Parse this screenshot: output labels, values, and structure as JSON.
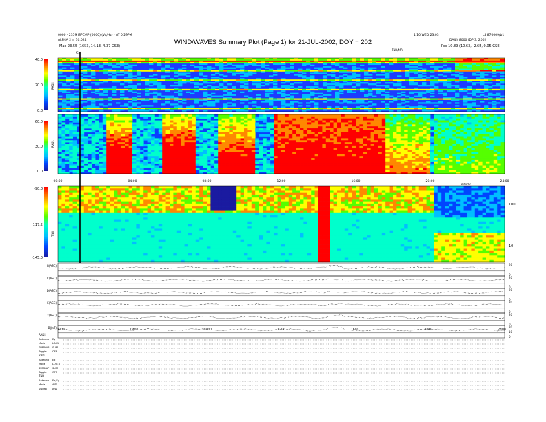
{
  "header": {
    "title": "WIND/WAVES Summary Plot (Page 1) for 21-JUL-2002, DOY = 202",
    "left_line1": "0000 - 2359 ISPCMP (0000) (Vs/Hz) - AT 0:29PM",
    "left_line2": "ALPHA 2 = 10.024",
    "left_line3": "Max 23.55 (1653, 14.13, 4.37 GSE)",
    "left_line3_label": "Pos",
    "right_line1": "1.10 WED 23:03",
    "right_line2": "DAILY 8000 (DP 3, 2002",
    "right_line3": "Pos 10.89 (10.63, -2.65, 0.05 GSE)",
    "right_top": "L5 870009/b1",
    "tnr_label": "TNR/MR",
    "cal_label": "Cal"
  },
  "chart_data": [
    {
      "type": "heatmap",
      "name": "RAD2",
      "ylabel": "RAD2",
      "colorbar_ticks": [
        "40.0",
        "20.0",
        "0.0"
      ],
      "colorbar_range": [
        0,
        40
      ],
      "xlim": [
        0,
        24
      ],
      "units": "MHz"
    },
    {
      "type": "heatmap",
      "name": "RAD1",
      "ylabel": "RAD1",
      "colorbar_ticks": [
        "60.0",
        "30.0",
        "0.0"
      ],
      "colorbar_range": [
        0,
        60
      ],
      "xlim": [
        0,
        24
      ],
      "x_ticks": [
        "00:00",
        "04:00",
        "08:00",
        "12:00",
        "16:00",
        "20:00",
        "24:00"
      ],
      "x_unit_label": "SRFQHU"
    },
    {
      "type": "heatmap",
      "name": "TNR",
      "ylabel": "TNR",
      "colorbar_ticks": [
        "-90.0",
        "-117.5",
        "-145.0"
      ],
      "colorbar_range": [
        -145,
        -90
      ],
      "right_ticks": [
        "100",
        "10"
      ],
      "xlim": [
        0,
        24
      ]
    },
    {
      "type": "line",
      "name": "B(ASC)",
      "label": "B(ASC)",
      "right_ticks": [
        "20",
        "0"
      ]
    },
    {
      "type": "line",
      "name": "C(ASC)",
      "label": "C(ASC)",
      "right_ticks": [
        "20",
        "0"
      ]
    },
    {
      "type": "line",
      "name": "D(ASC)",
      "label": "D(ASC)",
      "right_ticks": [
        "20",
        "0"
      ]
    },
    {
      "type": "line",
      "name": "E(ASC)",
      "label": "E(ASC)",
      "right_ticks": [
        "20",
        "0"
      ]
    },
    {
      "type": "line",
      "name": "X(ASC)",
      "label": "X(ASC)",
      "right_ticks": [
        "20",
        "0"
      ]
    },
    {
      "type": "line",
      "name": "|B|(nT)",
      "label": "|B|(nT)",
      "right_ticks": [
        "20",
        "10",
        "0"
      ],
      "x_ticks": [
        "0000",
        "0400",
        "0800",
        "1200",
        "1600",
        "2000",
        "2400"
      ]
    }
  ],
  "footer": {
    "rad2_header": "RAD2",
    "rad1_header": "RAD1",
    "tnr_header": "TNR",
    "rows": [
      {
        "k": "Antenna",
        "v": "Ey"
      },
      {
        "k": "Mode",
        "v": "LIN 1"
      },
      {
        "k": "SUMDAP",
        "v": "SUM"
      },
      {
        "k": "Toggle",
        "v": "OFF"
      },
      {
        "k": "Antenna",
        "v": "Ex"
      },
      {
        "k": "Mode",
        "v": "LOG 8"
      },
      {
        "k": "SUMDAP",
        "v": "SUM"
      },
      {
        "k": "Toggle",
        "v": "OFF"
      },
      {
        "k": "Antenna",
        "v": "Ex/Ey"
      },
      {
        "k": "Mode",
        "v": "A/D"
      },
      {
        "k": "Sweep",
        "v": "A/D"
      }
    ]
  },
  "colors": {
    "cmap": [
      "#000000",
      "#1a1aa0",
      "#0044ff",
      "#00bfff",
      "#00ffcc",
      "#55ff00",
      "#ffff00",
      "#ff8800",
      "#ff0000"
    ]
  }
}
